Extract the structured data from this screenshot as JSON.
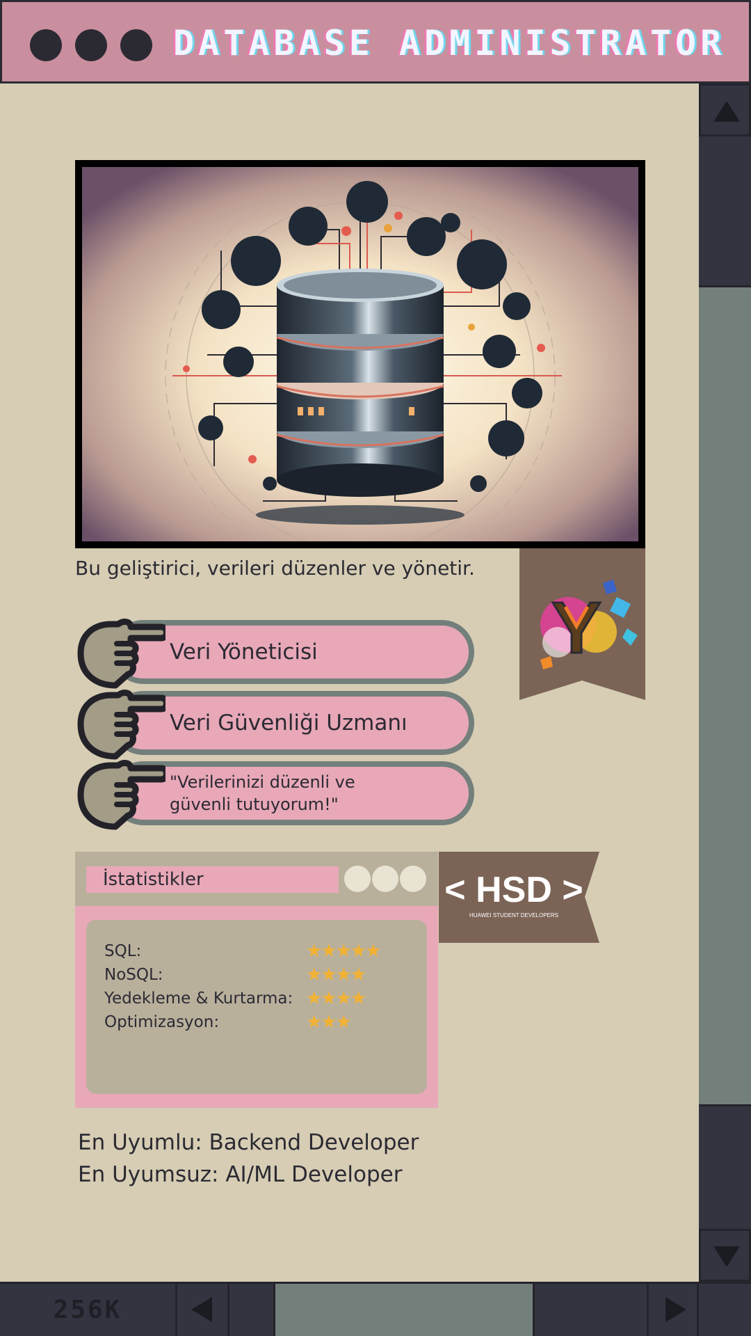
{
  "window": {
    "title": "DATABASE ADMINISTRATOR",
    "memory_label": "256K"
  },
  "hero": {
    "description": "Bu geliştirici, verileri düzenler ve yönetir."
  },
  "roles": [
    {
      "label": "Veri Yöneticisi"
    },
    {
      "label": "Veri Güvenliği Uzmanı"
    },
    {
      "label": "\"Verilerinizi düzenli ve güvenli tutuyorum!\""
    }
  ],
  "stats": {
    "title": "İstatistikler",
    "rows": [
      {
        "label": "SQL:",
        "rating": 5,
        "stars": "★★★★★"
      },
      {
        "label": "NoSQL:",
        "rating": 4,
        "stars": "★★★★"
      },
      {
        "label": "Yedekleme & Kurtarma:",
        "rating": 4,
        "stars": "★★★★"
      },
      {
        "label": "Optimizasyon:",
        "rating": 3,
        "stars": "★★★"
      }
    ]
  },
  "hsd_badge": {
    "main": "< HSD >",
    "sub": "HUAWEI STUDENT DEVELOPERS"
  },
  "compatibility": {
    "best": "En Uyumlu: Backend Developer",
    "worst": "En Uyumsuz: AI/ML Developer"
  },
  "colors": {
    "background": "#d6cdb4",
    "titlebar": "#c98f9e",
    "pill": "#e8a8b8",
    "pill_border": "#737f7b",
    "scrollbar": "#333440",
    "thumb": "#737f7b",
    "star": "#f3b233",
    "badge": "#7b6356"
  }
}
